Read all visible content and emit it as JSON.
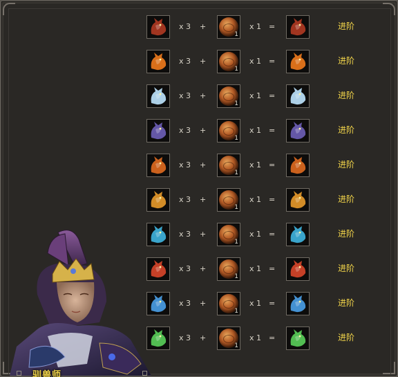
{
  "recipe_rows": [
    {
      "pet_icon": "red-spiked-beast-icon",
      "color": "#b13a22",
      "qty_pet": "x 3",
      "plus": "+",
      "material_icon": "evolution-orb-icon",
      "material_count": "1",
      "qty_material": "x 1",
      "equals": "=",
      "result_icon": "red-spiked-beast-icon",
      "action": "进阶"
    },
    {
      "pet_icon": "fire-fox-icon",
      "color": "#f07a1c",
      "qty_pet": "x 3",
      "plus": "+",
      "material_icon": "evolution-orb-icon",
      "material_count": "1",
      "qty_material": "x 1",
      "equals": "=",
      "result_icon": "fire-fox-icon",
      "action": "进阶"
    },
    {
      "pet_icon": "ice-fox-icon",
      "color": "#bfe6ff",
      "qty_pet": "x 3",
      "plus": "+",
      "material_icon": "evolution-orb-icon",
      "material_count": "1",
      "qty_material": "x 1",
      "equals": "=",
      "result_icon": "ice-fox-icon",
      "action": "进阶"
    },
    {
      "pet_icon": "shadow-wolf-icon",
      "color": "#6e5fb8",
      "qty_pet": "x 3",
      "plus": "+",
      "material_icon": "evolution-orb-icon",
      "material_count": "1",
      "qty_material": "x 1",
      "equals": "=",
      "result_icon": "shadow-wolf-icon",
      "action": "进阶"
    },
    {
      "pet_icon": "flame-beast-icon",
      "color": "#e06a1f",
      "qty_pet": "x 3",
      "plus": "+",
      "material_icon": "evolution-orb-icon",
      "material_count": "1",
      "qty_material": "x 1",
      "equals": "=",
      "result_icon": "flame-beast-icon",
      "action": "进阶"
    },
    {
      "pet_icon": "golden-dragon-icon",
      "color": "#e89a2a",
      "qty_pet": "x 3",
      "plus": "+",
      "material_icon": "evolution-orb-icon",
      "material_count": "1",
      "qty_material": "x 1",
      "equals": "=",
      "result_icon": "golden-dragon-icon",
      "action": "进阶"
    },
    {
      "pet_icon": "azure-wolf-icon",
      "color": "#3fb5e0",
      "qty_pet": "x 3",
      "plus": "+",
      "material_icon": "evolution-orb-icon",
      "material_count": "1",
      "qty_material": "x 1",
      "equals": "=",
      "result_icon": "azure-wolf-icon",
      "action": "进阶"
    },
    {
      "pet_icon": "crimson-dragon-icon",
      "color": "#d9462a",
      "qty_pet": "x 3",
      "plus": "+",
      "material_icon": "evolution-orb-icon",
      "material_count": "1",
      "qty_material": "x 1",
      "equals": "=",
      "result_icon": "crimson-dragon-icon",
      "action": "进阶"
    },
    {
      "pet_icon": "sky-dragon-icon",
      "color": "#4aa0e8",
      "qty_pet": "x 3",
      "plus": "+",
      "material_icon": "evolution-orb-icon",
      "material_count": "1",
      "qty_material": "x 1",
      "equals": "=",
      "result_icon": "sky-dragon-icon",
      "action": "进阶"
    },
    {
      "pet_icon": "jade-dragon-icon",
      "color": "#5ad05a",
      "qty_pet": "x 3",
      "plus": "+",
      "material_icon": "evolution-orb-icon",
      "material_count": "1",
      "qty_material": "x 1",
      "equals": "=",
      "result_icon": "jade-dragon-icon",
      "action": "进阶"
    }
  ],
  "npc": {
    "name": "驯兽师",
    "portrait_icon": "beast-tamer-portrait"
  },
  "theme": {
    "panel_bg": "#2a2825",
    "action_color": "#f2d54a",
    "text_color": "#d9d4c8"
  }
}
